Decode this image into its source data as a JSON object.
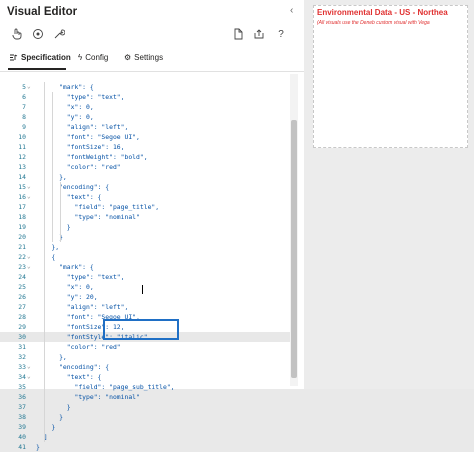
{
  "panel": {
    "title": "Visual Editor",
    "collapse_glyph": "‹"
  },
  "toolbar": {
    "left_icons": [
      "hand-pointer-icon",
      "target-icon",
      "wrench-icon"
    ],
    "right_icons": [
      "new-document-icon",
      "share-icon",
      "help-icon"
    ],
    "help_label": "?"
  },
  "tabs": [
    {
      "label": "Specification",
      "icon": "spec-icon",
      "active": true
    },
    {
      "label": "Config",
      "icon": "bolt-icon",
      "active": false
    },
    {
      "label": "Settings",
      "icon": "gear-icon",
      "active": false
    }
  ],
  "editor": {
    "lines": [
      {
        "n": "5",
        "fold": "⌄",
        "code": "      \"mark\": {"
      },
      {
        "n": "6",
        "fold": "",
        "code": "        \"type\": \"text\","
      },
      {
        "n": "7",
        "fold": "",
        "code": "        \"x\": 0,"
      },
      {
        "n": "8",
        "fold": "",
        "code": "        \"y\": 0,"
      },
      {
        "n": "9",
        "fold": "",
        "code": "        \"align\": \"left\","
      },
      {
        "n": "10",
        "fold": "",
        "code": "        \"font\": \"Segoe UI\","
      },
      {
        "n": "11",
        "fold": "",
        "code": "        \"fontSize\": 16,"
      },
      {
        "n": "12",
        "fold": "",
        "code": "        \"fontWeight\": \"bold\","
      },
      {
        "n": "13",
        "fold": "",
        "code": "        \"color\": \"red\""
      },
      {
        "n": "14",
        "fold": "",
        "code": "      },"
      },
      {
        "n": "15",
        "fold": "⌄",
        "code": "      \"encoding\": {"
      },
      {
        "n": "16",
        "fold": "⌄",
        "code": "        \"text\": {"
      },
      {
        "n": "17",
        "fold": "",
        "code": "          \"field\": \"page_title\","
      },
      {
        "n": "18",
        "fold": "",
        "code": "          \"type\": \"nominal\""
      },
      {
        "n": "19",
        "fold": "",
        "code": "        }"
      },
      {
        "n": "20",
        "fold": "",
        "code": "      }"
      },
      {
        "n": "21",
        "fold": "",
        "code": "    },"
      },
      {
        "n": "22",
        "fold": "⌄",
        "code": "    {"
      },
      {
        "n": "23",
        "fold": "⌄",
        "code": "      \"mark\": {"
      },
      {
        "n": "24",
        "fold": "",
        "code": "        \"type\": \"text\","
      },
      {
        "n": "25",
        "fold": "",
        "code": "        \"x\": 0,"
      },
      {
        "n": "26",
        "fold": "",
        "code": "        \"y\": 20,"
      },
      {
        "n": "27",
        "fold": "",
        "code": "        \"align\": \"left\","
      },
      {
        "n": "28",
        "fold": "",
        "code": "        \"font\": \"Segoe UI\","
      },
      {
        "n": "29",
        "fold": "",
        "code": "        \"fontSize\": 12,"
      },
      {
        "n": "30",
        "fold": "",
        "code": "        \"fontStyle\": \"italic\","
      },
      {
        "n": "31",
        "fold": "",
        "code": "        \"color\": \"red\""
      },
      {
        "n": "32",
        "fold": "",
        "code": "      },"
      },
      {
        "n": "33",
        "fold": "⌄",
        "code": "      \"encoding\": {"
      },
      {
        "n": "34",
        "fold": "⌄",
        "code": "        \"text\": {"
      },
      {
        "n": "35",
        "fold": "",
        "code": "          \"field\": \"page_sub_title\","
      },
      {
        "n": "36",
        "fold": "",
        "code": "          \"type\": \"nominal\""
      },
      {
        "n": "37",
        "fold": "",
        "code": "        }"
      },
      {
        "n": "38",
        "fold": "",
        "code": "      }"
      },
      {
        "n": "39",
        "fold": "",
        "code": "    }"
      },
      {
        "n": "40",
        "fold": "",
        "code": "  ]"
      },
      {
        "n": "41",
        "fold": "",
        "code": "}"
      }
    ],
    "current_line": "30"
  },
  "visual": {
    "title": "Environmental Data - US - Northea",
    "subtitle": "(All visuals use the Deneb custom visual with Vega",
    "text_color": "#e03030"
  },
  "colors": {
    "accent": "#1f6fc5",
    "line_number": "#237893",
    "code_text": "#0451a5"
  }
}
